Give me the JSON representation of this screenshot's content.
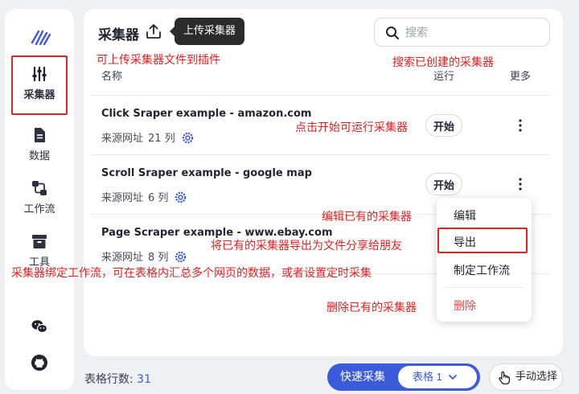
{
  "sidebar": {
    "items": [
      {
        "label": "采集器",
        "icon": "sliders-icon"
      },
      {
        "label": "数据",
        "icon": "document-icon"
      },
      {
        "label": "工作流",
        "icon": "workflow-icon"
      },
      {
        "label": "工具",
        "icon": "toolbox-icon"
      }
    ],
    "bottom_icons": [
      "wechat-icon",
      "github-icon"
    ]
  },
  "header": {
    "title": "采集器",
    "upload_tooltip": "上传采集器",
    "search_placeholder": "搜索"
  },
  "table": {
    "columns": {
      "name": "名称",
      "run": "运行",
      "more": "更多"
    },
    "rows": [
      {
        "name": "Click Sraper example - amazon.com",
        "source": "来源网址",
        "cols": "21 列",
        "start": "开始"
      },
      {
        "name": "Scroll Sraper example - google map",
        "source": "来源网址",
        "cols": "6 列",
        "start": "开始"
      },
      {
        "name": "Page Scraper example - www.ebay.com",
        "source": "来源网址",
        "cols": "8 列"
      }
    ]
  },
  "context_menu": {
    "items": [
      "编辑",
      "导出",
      "制定工作流",
      "删除"
    ]
  },
  "footer": {
    "rows_label": "表格行数:",
    "rows_count": "31",
    "quick_collect": "快速采集",
    "table_select": "表格 1",
    "manual_select": "手动选择"
  },
  "annotations": {
    "upload": "可上传采集器文件到插件",
    "search": "搜索已创建的采集器",
    "start": "点击开始可运行采集器",
    "edit": "编辑已有的采集器",
    "export": "将已有的采集器导出为文件分享给朋友",
    "workflow": "采集器绑定工作流，可在表格内汇总多个网页的数据，或者设置定时采集",
    "delete": "删除已有的采集器"
  },
  "colors": {
    "accent": "#3b5bdb",
    "annotation": "#e02020",
    "danger": "#e04848"
  }
}
